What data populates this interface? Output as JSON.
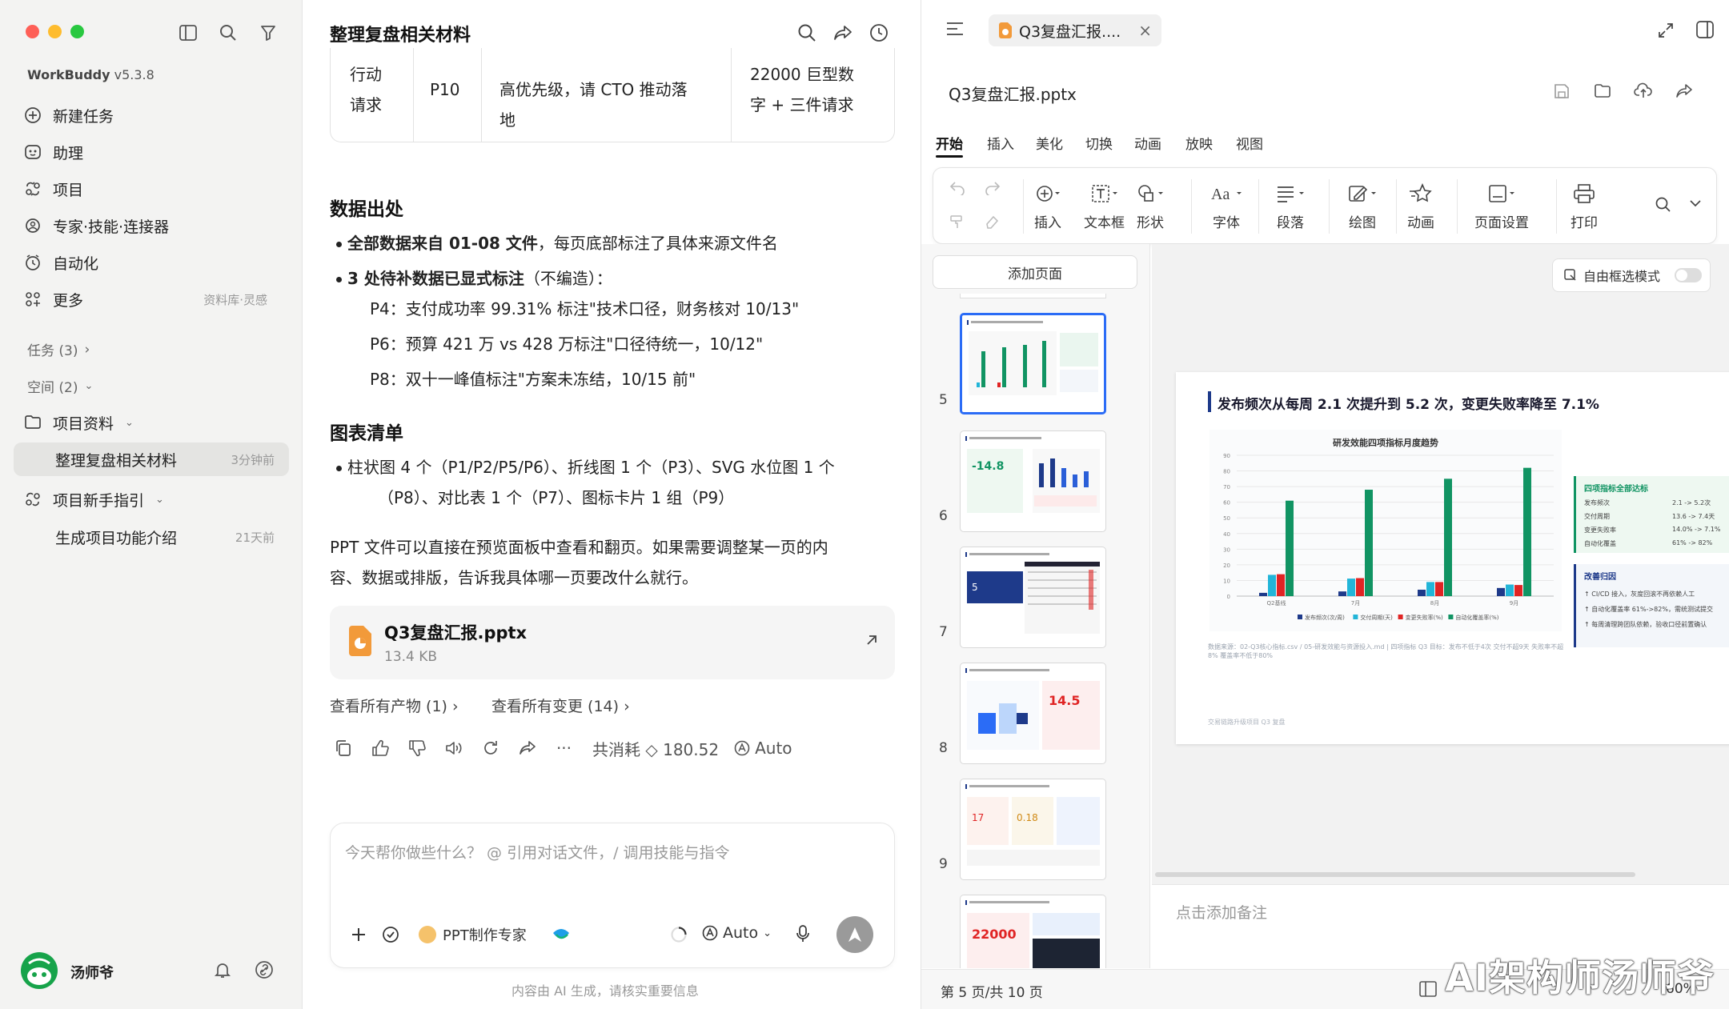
{
  "sidebar": {
    "brand": "WorkBuddy",
    "version": "v5.3.8",
    "nav": [
      {
        "label": "新建任务",
        "icon": "plus-circle-icon"
      },
      {
        "label": "助理",
        "icon": "assistant-icon"
      },
      {
        "label": "项目",
        "icon": "project-icon"
      },
      {
        "label": "专家·技能·连接器",
        "icon": "expert-icon"
      },
      {
        "label": "自动化",
        "icon": "clock-icon"
      },
      {
        "label": "更多",
        "icon": "grid-icon",
        "right": "资料库·灵感"
      }
    ],
    "tasks_label": "任务 (3)",
    "spaces_label": "空间 (2)",
    "folder_label": "项目资料",
    "active_item": {
      "label": "整理复盘相关材料",
      "time": "3分钟前"
    },
    "guide_label": "项目新手指引",
    "guide_item": {
      "label": "生成项目功能介绍",
      "time": "21天前"
    },
    "user": "汤师爷"
  },
  "chat": {
    "title": "整理复盘相关材料",
    "table_row": [
      "行动",
      "请求",
      "P10",
      "高优先级，请 CTO 推动落",
      "地",
      "22000 巨型数",
      "字 + 三件请求"
    ],
    "section1": "数据出处",
    "b1_bold": "全部数据来自 01-08 文件",
    "b1_rest": "，每页底部标注了具体来源文件名",
    "b2_bold": "3 处待补数据已显式标注",
    "b2_rest": "（不编造）：",
    "b3": "P4：支付成功率 99.31% 标注\"技术口径，财务核对 10/13\"",
    "b4": "P6：预算 421 万 vs 428 万标注\"口径待统一，10/12\"",
    "b5": "P8：双十一峰值标注\"方案未冻结，10/15 前\"",
    "section2": "图表清单",
    "c1a": "柱状图 4 个（P1/P2/P5/P6）、折线图 1 个（P3）、SVG 水位图 1 个",
    "c1b": "（P8）、对比表 1 个（P7）、图标卡片 1 组（P9）",
    "para_a": "PPT 文件可以直接在预览面板中查看和翻页。如果需要调整某一页的内",
    "para_b": "容、数据或排版，告诉我具体哪一页要改什么就行。",
    "file_name": "Q3复盘汇报.pptx",
    "file_size": "13.4 KB",
    "link_outputs": "查看所有产物 (1)",
    "link_changes": "查看所有变更 (14)",
    "cost_label": "共消耗",
    "cost_value": "180.52",
    "auto_label": "Auto",
    "input_placeholder": "今天帮你做些什么？ @ 引用对话文件，/ 调用技能与指令",
    "expert_label": "PPT制作专家",
    "model_label": "Auto",
    "footer": "内容由 AI 生成，请核实重要信息"
  },
  "preview": {
    "tab_label": "Q3复盘汇报....",
    "file_name": "Q3复盘汇报.pptx",
    "menu": [
      "开始",
      "插入",
      "美化",
      "切换",
      "动画",
      "放映",
      "视图"
    ],
    "tools": [
      "插入",
      "文本框",
      "形状",
      "字体",
      "段落",
      "绘图",
      "动画",
      "页面设置",
      "打印"
    ],
    "add_page": "添加页面",
    "free_select": "自由框选模式",
    "thumb_numbers": [
      "5",
      "6",
      "7",
      "8",
      "9"
    ],
    "notes_placeholder": "点击添加备注",
    "page_status": "第 5 页/共 10 页",
    "zoom": "60%",
    "watermark": "AI架构师汤师爷"
  },
  "slide": {
    "title": "发布频次从每周 2.1 次提升到 5.2 次，变更失败率降至 7.1%",
    "side_title": "四项指标全部达标",
    "side_rows": [
      {
        "k": "发布频次",
        "v": "2.1 -> 5.2次"
      },
      {
        "k": "交付周期",
        "v": "13.6 -> 7.4天"
      },
      {
        "k": "变更失败率",
        "v": "14.0% -> 7.1%"
      },
      {
        "k": "自动化覆盖",
        "v": "61% -> 82%"
      }
    ],
    "reason_title": "改善归因",
    "reasons": [
      "CI/CD 接入，灰度回滚不再依赖人工",
      "自动化覆盖率 61%->82%，需统测试提交",
      "每周清理跨团队依赖，验收口径前置确认"
    ],
    "source": "数据来源：02-Q3核心指标.csv / 05-研发效能与资源投入.md | 四项指标 Q3 目标：发布不低于4次 交付不超9天 失败率不超8% 覆盖率不低于80%",
    "footer": "交易链路升级项目 Q3 复盘"
  },
  "chart_data": {
    "type": "bar",
    "title": "研发效能四项指标月度趋势",
    "categories": [
      "Q2基线",
      "7月",
      "8月",
      "9月"
    ],
    "series": [
      {
        "name": "发布频次(次/周)",
        "values": [
          2.1,
          3.0,
          4.1,
          5.2
        ],
        "color": "#1e3a8a"
      },
      {
        "name": "交付周期(天)",
        "values": [
          13.6,
          11.2,
          9.0,
          7.4
        ],
        "color": "#22b5d8"
      },
      {
        "name": "变更失败率(%)",
        "values": [
          14.0,
          11.5,
          9.0,
          7.1
        ],
        "color": "#e02424"
      },
      {
        "name": "自动化覆盖率(%)",
        "values": [
          61,
          68,
          75,
          82
        ],
        "color": "#119463"
      }
    ],
    "ylim": [
      0,
      90
    ],
    "yticks": [
      0,
      10,
      20,
      30,
      40,
      50,
      60,
      70,
      80,
      90
    ],
    "legend": "bottom",
    "grid": true
  }
}
